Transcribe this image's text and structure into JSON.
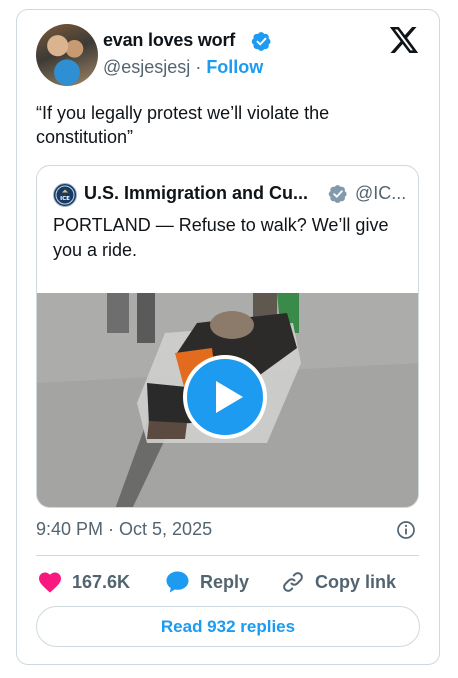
{
  "author": {
    "display_name": "evan loves worf",
    "handle": "@esjesjesj",
    "separator": "·",
    "follow_label": "Follow"
  },
  "tweet": {
    "text": "“If you legally protest we’ll violate the constitution”"
  },
  "quoted_tweet": {
    "display_name": "U.S. Immigration and Cu...",
    "handle": "@IC...",
    "avatar_label": "ICE",
    "text": "PORTLAND — Refuse to walk? We’ll give you a ride."
  },
  "meta": {
    "timestamp": "9:40 PM · Oct 5, 2025"
  },
  "actions": {
    "like_count": "167.6K",
    "reply_label": "Reply",
    "copy_link_label": "Copy link"
  },
  "read_replies_label": "Read 932 replies",
  "colors": {
    "accent": "#1d9bf0",
    "like": "#f91880",
    "text": "#0f1419",
    "secondary": "#536471",
    "border": "#cfd9de"
  },
  "icons": [
    "verified-badge-icon",
    "x-logo-icon",
    "play-icon",
    "info-icon",
    "heart-icon",
    "reply-bubble-icon",
    "link-icon"
  ]
}
